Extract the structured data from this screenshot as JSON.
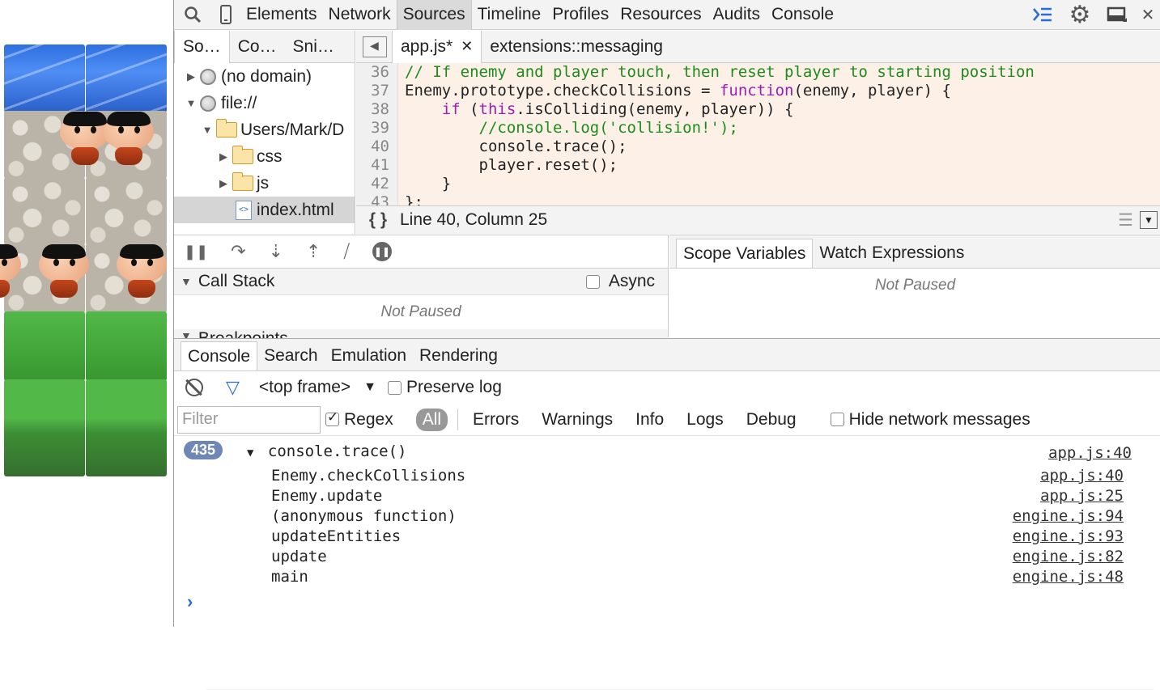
{
  "toolbar": {
    "tabs": [
      "Elements",
      "Network",
      "Sources",
      "Timeline",
      "Profiles",
      "Resources",
      "Audits",
      "Console"
    ],
    "active_tab": "Sources"
  },
  "navigator": {
    "tabs": [
      "So…",
      "Co…",
      "Sni…"
    ],
    "tree": [
      {
        "label": "(no domain)"
      },
      {
        "label": "file://"
      },
      {
        "label": "Users/Mark/D"
      },
      {
        "label": "css"
      },
      {
        "label": "js"
      },
      {
        "label": "index.html"
      }
    ]
  },
  "editor": {
    "tabs": [
      "app.js*",
      "extensions::messaging"
    ],
    "lines": [
      {
        "n": "36",
        "parts": [
          {
            "t": "// If enemy and player touch, then reset player to starting position",
            "c": "cm"
          }
        ]
      },
      {
        "n": "37",
        "parts": [
          {
            "t": "Enemy.prototype.checkCollisions = ",
            "c": ""
          },
          {
            "t": "function",
            "c": "kw"
          },
          {
            "t": "(enemy, player) {",
            "c": ""
          }
        ]
      },
      {
        "n": "38",
        "parts": [
          {
            "t": "    ",
            "c": ""
          },
          {
            "t": "if",
            "c": "kw"
          },
          {
            "t": " (",
            "c": ""
          },
          {
            "t": "this",
            "c": "kw"
          },
          {
            "t": ".isColliding(enemy, player)) {",
            "c": ""
          }
        ]
      },
      {
        "n": "39",
        "parts": [
          {
            "t": "        //console.log(",
            "c": "cm"
          },
          {
            "t": "'collision!'",
            "c": "cm"
          },
          {
            "t": ");",
            "c": "cm"
          }
        ]
      },
      {
        "n": "40",
        "parts": [
          {
            "t": "        console.trace();",
            "c": ""
          }
        ]
      },
      {
        "n": "41",
        "parts": [
          {
            "t": "        player.reset();",
            "c": ""
          }
        ]
      },
      {
        "n": "42",
        "parts": [
          {
            "t": "    }",
            "c": ""
          }
        ]
      },
      {
        "n": "43",
        "parts": [
          {
            "t": "};",
            "c": ""
          }
        ]
      }
    ],
    "status": "Line 40, Column 25"
  },
  "debugger": {
    "call_stack_label": "Call Stack",
    "async_label": "Async",
    "not_paused": "Not Paused",
    "breakpoints_label": "Breakpoints"
  },
  "scope": {
    "tabs": [
      "Scope Variables",
      "Watch Expressions"
    ],
    "not_paused": "Not Paused"
  },
  "drawer": {
    "tabs": [
      "Console",
      "Search",
      "Emulation",
      "Rendering"
    ],
    "frame_select": "<top frame>",
    "preserve_log": "Preserve log",
    "filter_placeholder": "Filter",
    "regex": "Regex",
    "levels": [
      "All",
      "Errors",
      "Warnings",
      "Info",
      "Logs",
      "Debug"
    ],
    "hide_network": "Hide network messages"
  },
  "console": {
    "count": "435",
    "message": "console.trace()",
    "message_location": "app.js:40",
    "frames": [
      {
        "fn": "Enemy.checkCollisions",
        "loc": "app.js:40"
      },
      {
        "fn": "Enemy.update",
        "loc": "app.js:25"
      },
      {
        "fn": "(anonymous function)",
        "loc": "engine.js:94"
      },
      {
        "fn": "updateEntities",
        "loc": "engine.js:93"
      },
      {
        "fn": "update",
        "loc": "engine.js:82"
      },
      {
        "fn": "main",
        "loc": "engine.js:48"
      }
    ]
  }
}
